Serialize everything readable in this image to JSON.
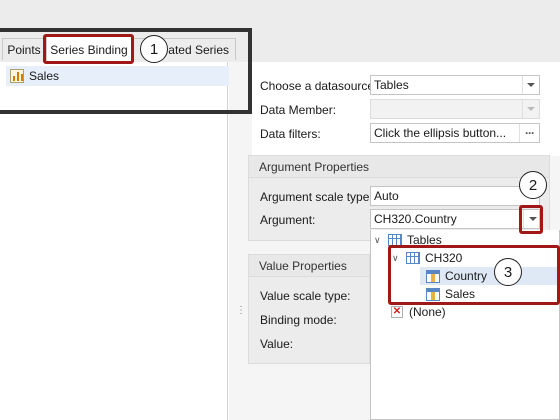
{
  "tabs": [
    {
      "label": "Points"
    },
    {
      "label": "Series Binding"
    },
    {
      "label": "Auto-Created Series",
      "visible": "reated Series"
    }
  ],
  "series_list": [
    {
      "label": "Sales"
    }
  ],
  "datasource": {
    "choose_label": "Choose a datasource:",
    "choose_value": "Tables",
    "member_label": "Data Member:",
    "member_value": "",
    "filters_label": "Data filters:",
    "filters_value": "Click the ellipsis button...",
    "ellipsis": "···"
  },
  "argument_properties": {
    "title": "Argument Properties",
    "scale_label": "Argument scale type:",
    "scale_value": "Auto",
    "argument_label": "Argument:",
    "argument_value": "CH320.Country"
  },
  "value_properties": {
    "title": "Value Properties",
    "scale_label": "Value scale type:",
    "binding_label": "Binding mode:",
    "value_label": "Value:"
  },
  "tree": {
    "root": "Tables",
    "table": "CH320",
    "columns": [
      "Country",
      "Sales"
    ],
    "none": "(None)"
  },
  "callouts": [
    "1",
    "2",
    "3"
  ],
  "colors": {
    "highlight": "#a01818",
    "selection": "#e6effa",
    "frame": "#333333"
  }
}
